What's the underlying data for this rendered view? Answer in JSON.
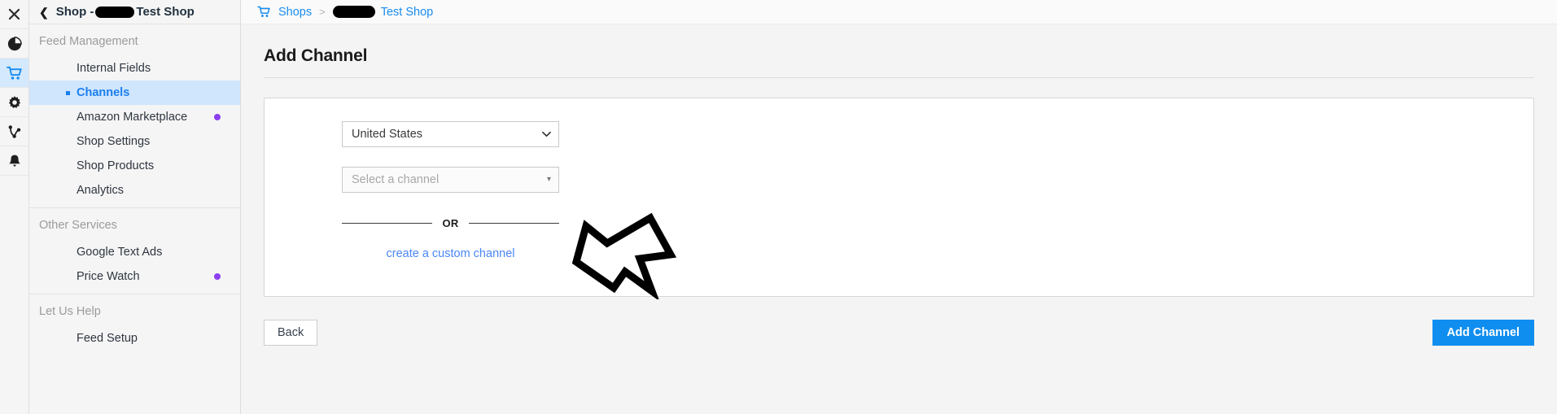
{
  "icon_rail": {
    "items": [
      {
        "name": "close-icon",
        "glyph": "close"
      },
      {
        "name": "pie-chart-icon",
        "glyph": "pie"
      },
      {
        "name": "cart-icon",
        "glyph": "cart",
        "active": true
      },
      {
        "name": "gear-icon",
        "glyph": "gear"
      },
      {
        "name": "share-nodes-icon",
        "glyph": "share"
      },
      {
        "name": "bell-icon",
        "glyph": "bell"
      }
    ]
  },
  "sidebar": {
    "shop_title_prefix": "Shop - ",
    "shop_title_suffix": "Test Shop",
    "groups": [
      {
        "label": "Feed Management",
        "items": [
          {
            "label": "Internal Fields",
            "active": false,
            "dot": false
          },
          {
            "label": "Channels",
            "active": true,
            "dot": false
          },
          {
            "label": "Amazon Marketplace",
            "active": false,
            "dot": true
          },
          {
            "label": "Shop Settings",
            "active": false,
            "dot": false
          },
          {
            "label": "Shop Products",
            "active": false,
            "dot": false
          },
          {
            "label": "Analytics",
            "active": false,
            "dot": false
          }
        ]
      },
      {
        "label": "Other Services",
        "items": [
          {
            "label": "Google Text Ads",
            "active": false,
            "dot": false
          },
          {
            "label": "Price Watch",
            "active": false,
            "dot": true
          }
        ]
      },
      {
        "label": "Let Us Help",
        "items": [
          {
            "label": "Feed Setup",
            "active": false,
            "dot": false
          }
        ]
      }
    ]
  },
  "breadcrumb": {
    "shops_label": "Shops",
    "separator": ">",
    "current_label": "Test Shop"
  },
  "main": {
    "page_title": "Add Channel",
    "country_select": {
      "value": "United States",
      "chevron": "⌄"
    },
    "channel_select": {
      "placeholder": "Select a channel",
      "triangle": "▾"
    },
    "or_label": "OR",
    "custom_channel_link": "create a custom channel",
    "back_button": "Back",
    "add_channel_button": "Add Channel"
  },
  "colors": {
    "accent_blue": "#108ef0",
    "link_blue": "#4a86f7",
    "active_nav_bg": "#cfe6fd",
    "badge_purple": "#8b3ff0",
    "page_bg": "#f4f4f4"
  }
}
